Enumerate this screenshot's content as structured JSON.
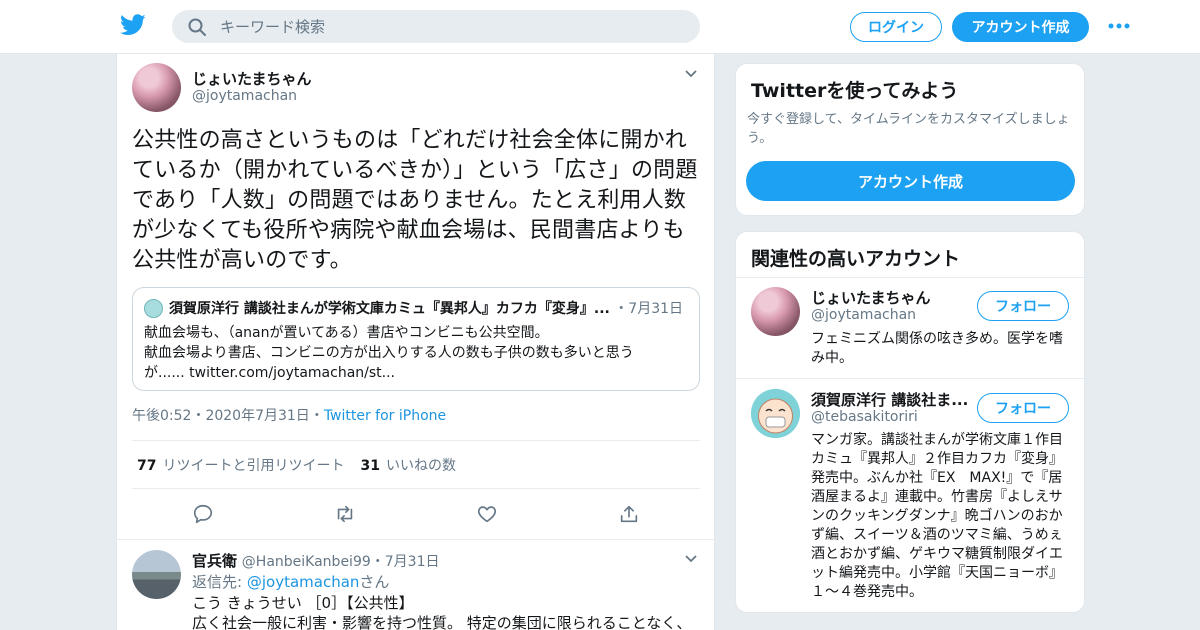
{
  "colors": {
    "accent": "#1da1f2",
    "link": "#1b95e0",
    "muted": "#657786",
    "text": "#14171a",
    "background": "#e6ecf0"
  },
  "header": {
    "logo_icon": "twitter-bird-icon",
    "search_placeholder": "キーワード検索",
    "login_label": "ログイン",
    "signup_label": "アカウント作成",
    "more_icon": "more-dots-icon"
  },
  "tweet": {
    "author_name": "じょいたまちゃん",
    "author_handle": "@joytamachan",
    "text": "公共性の高さというものは「どれだけ社会全体に開かれているか（開かれているべきか）」という「広さ」の問題であり「人数」の問題ではありません。たとえ利用人数が少なくても役所や病院や献血会場は、民間書店よりも公共性が高いのです。",
    "quote": {
      "author": "須賀原洋行 講談社まんが学術文庫カミュ『異邦人』カフカ『変身』...",
      "separator": "・",
      "date": "7月31日",
      "body_line1": "献血会場も、（ananが置いてある）書店やコンビニも公共空間。",
      "body_line2": "献血会場より書店、コンビニの方が出入りする人の数も子供の数も多いと思う",
      "body_line3": "が...... twitter.com/joytamachan/st..."
    },
    "time": "午後0:52",
    "sep1": "・",
    "date": "2020年7月31日",
    "sep2": "・",
    "source": "Twitter for iPhone",
    "retweet_count": "77",
    "retweet_label": "リツイートと引用リツイート",
    "like_count": "31",
    "like_label": "いいねの数"
  },
  "reply": {
    "author_name": "官兵衛",
    "author_handle": "@HanbeiKanbei99",
    "separator": "・",
    "date": "7月31日",
    "reply_to_label": "返信先:",
    "reply_to_handle": "@joytamachan",
    "reply_to_suffix": "さん",
    "body_line1": "こう きょうせい ［0］【公共性】",
    "body_line2": "広く社会一般に利害・影響を持つ性質。 特定の集団に限られることなく、"
  },
  "sidebar": {
    "signup_card": {
      "title": "Twitterを使ってみよう",
      "description": "今すぐ登録して、タイムラインをカスタマイズしましょう。",
      "button_label": "アカウント作成"
    },
    "related": {
      "title": "関連性の高いアカウント",
      "accounts": [
        {
          "name": "じょいたまちゃん",
          "handle": "@joytamachan",
          "follow_label": "フォロー",
          "bio": "フェミニズム関係の呟き多め。医学を嗜み中。"
        },
        {
          "name": "須賀原洋行 講談社ま...",
          "handle": "@tebasakitoriri",
          "follow_label": "フォロー",
          "bio": "マンガ家。講談社まんが学術文庫１作目カミュ『異邦人』２作目カフカ『変身』発売中。ぶんか社『EX　MAX!』で『居酒屋まるよ』連載中。竹書房『よしえサンのクッキングダンナ』晩ゴハンのおかず編、スイーツ＆酒のツマミ編、うめぇ酒とおかず編、ゲキウマ糖質制限ダイエット編発売中。小学館『天国ニョーボ』１〜４巻発売中。"
        }
      ]
    }
  }
}
